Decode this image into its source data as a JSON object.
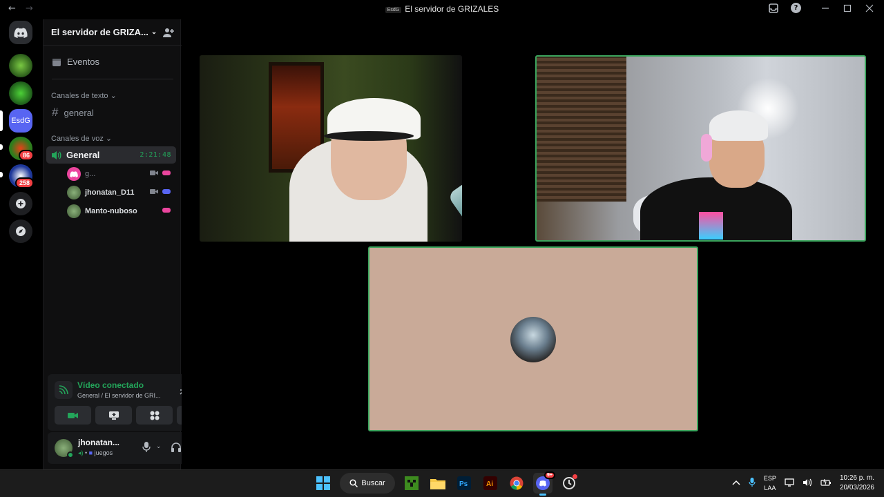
{
  "window": {
    "title": "El servidor de GRIZALES",
    "title_badge": "EsdG",
    "back": "←",
    "forward": "→"
  },
  "rail": {
    "servers": [
      {
        "label": "",
        "badge": ""
      },
      {
        "label": "",
        "badge": ""
      },
      {
        "label": "EsdG",
        "badge": ""
      },
      {
        "label": "",
        "badge": "86"
      },
      {
        "label": "",
        "badge": "258"
      }
    ]
  },
  "server": {
    "name": "El servidor de GRIZA...",
    "events_label": "Eventos",
    "text_category": "Canales de texto",
    "text_channels": [
      "general"
    ],
    "voice_category": "Canales de voz",
    "voice_channel": {
      "name": "General",
      "timer": "2:21:48"
    },
    "voice_users": [
      {
        "name": "g..."
      },
      {
        "name": "jhonatan_D11"
      },
      {
        "name": "Manto-nuboso"
      }
    ]
  },
  "voice_panel": {
    "title": "Vídeo conectado",
    "subtitle": "General / El servidor de GRI..."
  },
  "user_panel": {
    "username": "jhonatan...",
    "status": "juegos"
  },
  "taskbar": {
    "search_label": "Buscar",
    "discord_badge": "9+",
    "lang_top": "ESP",
    "lang_bottom": "LAA",
    "time": "10:26 p. m.",
    "date": "20/03/2026"
  },
  "colors": {
    "accent_green": "#23a55a",
    "speaking_border": "#3ba55d",
    "badge_red": "#f23f43",
    "blurple": "#5865f2",
    "tile3_bg": "#c9aa98"
  }
}
